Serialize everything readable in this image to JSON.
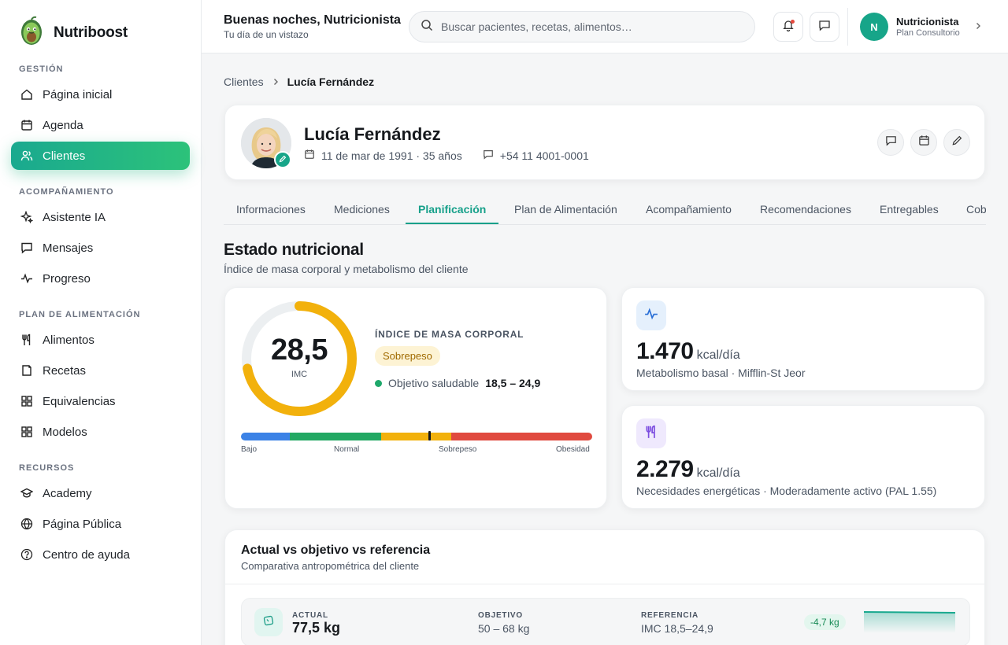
{
  "brand": {
    "name": "Nutriboost"
  },
  "sidebar": {
    "sections": [
      {
        "title": "GESTIÓN",
        "items": [
          {
            "label": "Página inicial",
            "icon": "home-icon"
          },
          {
            "label": "Agenda",
            "icon": "calendar-icon"
          },
          {
            "label": "Clientes",
            "icon": "users-icon",
            "active": true
          }
        ]
      },
      {
        "title": "ACOMPAÑAMIENTO",
        "items": [
          {
            "label": "Asistente IA",
            "icon": "sparkles-icon"
          },
          {
            "label": "Mensajes",
            "icon": "message-icon"
          },
          {
            "label": "Progreso",
            "icon": "activity-icon"
          }
        ]
      },
      {
        "title": "PLAN DE ALIMENTACIÓN",
        "items": [
          {
            "label": "Alimentos",
            "icon": "utensils-icon"
          },
          {
            "label": "Recetas",
            "icon": "book-icon"
          },
          {
            "label": "Equivalencias",
            "icon": "grid-icon"
          },
          {
            "label": "Modelos",
            "icon": "grid-icon"
          }
        ]
      },
      {
        "title": "RECURSOS",
        "items": [
          {
            "label": "Academy",
            "icon": "graduation-cap-icon"
          },
          {
            "label": "Página Pública",
            "icon": "globe-icon"
          },
          {
            "label": "Centro de ayuda",
            "icon": "help-circle-icon"
          }
        ]
      }
    ]
  },
  "header": {
    "greeting": "Buenas noches, Nutricionista",
    "subtitle": "Tu día de un vistazo",
    "search_placeholder": "Buscar pacientes, recetas, alimentos…",
    "user": {
      "initial": "N",
      "name": "Nutricionista",
      "plan": "Plan Consultorio"
    }
  },
  "breadcrumb": {
    "parent": "Clientes",
    "current": "Lucía Fernández"
  },
  "profile": {
    "name": "Lucía Fernández",
    "birth": "11 de mar de 1991 · 35 años",
    "phone": "+54 11 4001-0001"
  },
  "tabs": [
    "Informaciones",
    "Mediciones",
    "Planificación",
    "Plan de Alimentación",
    "Acompañamiento",
    "Recomendaciones",
    "Entregables",
    "Cob"
  ],
  "active_tab": "Planificación",
  "section": {
    "title": "Estado nutricional",
    "subtitle": "Índice de masa corporal y metabolismo del cliente"
  },
  "imc": {
    "value": "28,5",
    "value_numeric": 28.5,
    "label": "IMC",
    "title": "ÍNDICE DE MASA CORPORAL",
    "badge": "Sobrepeso",
    "goal_label": "Objetivo saludable",
    "goal_value": "18,5 – 24,9",
    "gauge_fraction": 0.72,
    "scale_labels": [
      "Bajo",
      "Normal",
      "Sobrepeso",
      "Obesidad"
    ],
    "colors": {
      "gauge": "#f2b10c",
      "track": "#eceff1",
      "low": "#3b82e6",
      "normal": "#22a863",
      "over": "#f2b10c",
      "obese": "#e04a3f"
    }
  },
  "stats": [
    {
      "value": "1.470",
      "unit": "kcal/día",
      "desc": "Metabolismo basal · Mifflin-St Jeor",
      "icon": "activity-icon",
      "color": "#e5f0fc"
    },
    {
      "value": "2.279",
      "unit": "kcal/día",
      "desc": "Necesidades energéticas · Moderadamente activo (PAL 1.55)",
      "icon": "utensils-icon",
      "color": "#efe9fd"
    }
  ],
  "comparison": {
    "title": "Actual vs objetivo vs referencia",
    "subtitle": "Comparativa antropométrica del cliente",
    "row": {
      "actual_label": "ACTUAL",
      "actual_value": "77,5 kg",
      "goal_label": "OBJETIVO",
      "goal_value": "50 – 68 kg",
      "ref_label": "REFERENCIA",
      "ref_value": "IMC 18,5–24,9",
      "delta": "-4,7 kg"
    }
  },
  "colors": {
    "accent": "#17a589",
    "accent_gradient_end": "#2cc27a",
    "notification": "#e5483d"
  }
}
